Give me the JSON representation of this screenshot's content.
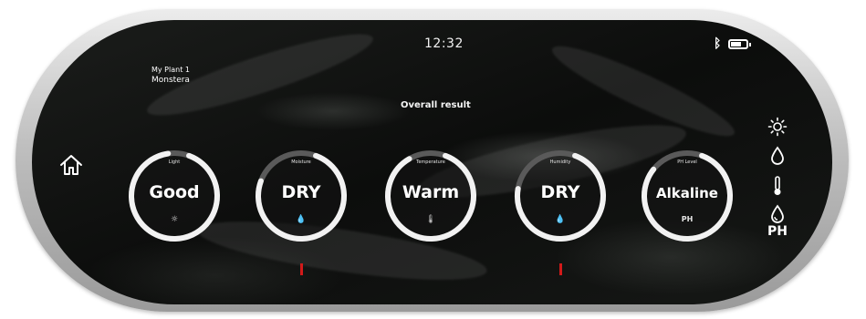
{
  "status_bar": {
    "time": "12:32",
    "battery_level": 0.8
  },
  "plant": {
    "name": "My Plant 1",
    "species": "Monstera"
  },
  "overall_title": "Overall result",
  "gauges": [
    {
      "label": "Light",
      "value": "Good",
      "sub": "☼",
      "level": 0.92,
      "indicator": false
    },
    {
      "label": "Moisture",
      "value": "DRY",
      "sub": "💧",
      "level": 0.75,
      "indicator": true
    },
    {
      "label": "Temperature",
      "value": "Warm",
      "sub": "🌡",
      "level": 0.86,
      "indicator": false
    },
    {
      "label": "Humidity",
      "value": "DRY",
      "sub": "💧",
      "level": 0.72,
      "indicator": true
    },
    {
      "label": "PH Level",
      "value": "Alkaline",
      "sub": "PH",
      "level": 0.8,
      "indicator": false
    }
  ],
  "side_panel": {
    "ph_label": "PH"
  },
  "colors": {
    "ring": "#f2f2f2",
    "ring_track": "#5a5a5a",
    "indicator": "#d21a1a",
    "screen_bg": "#121312"
  }
}
